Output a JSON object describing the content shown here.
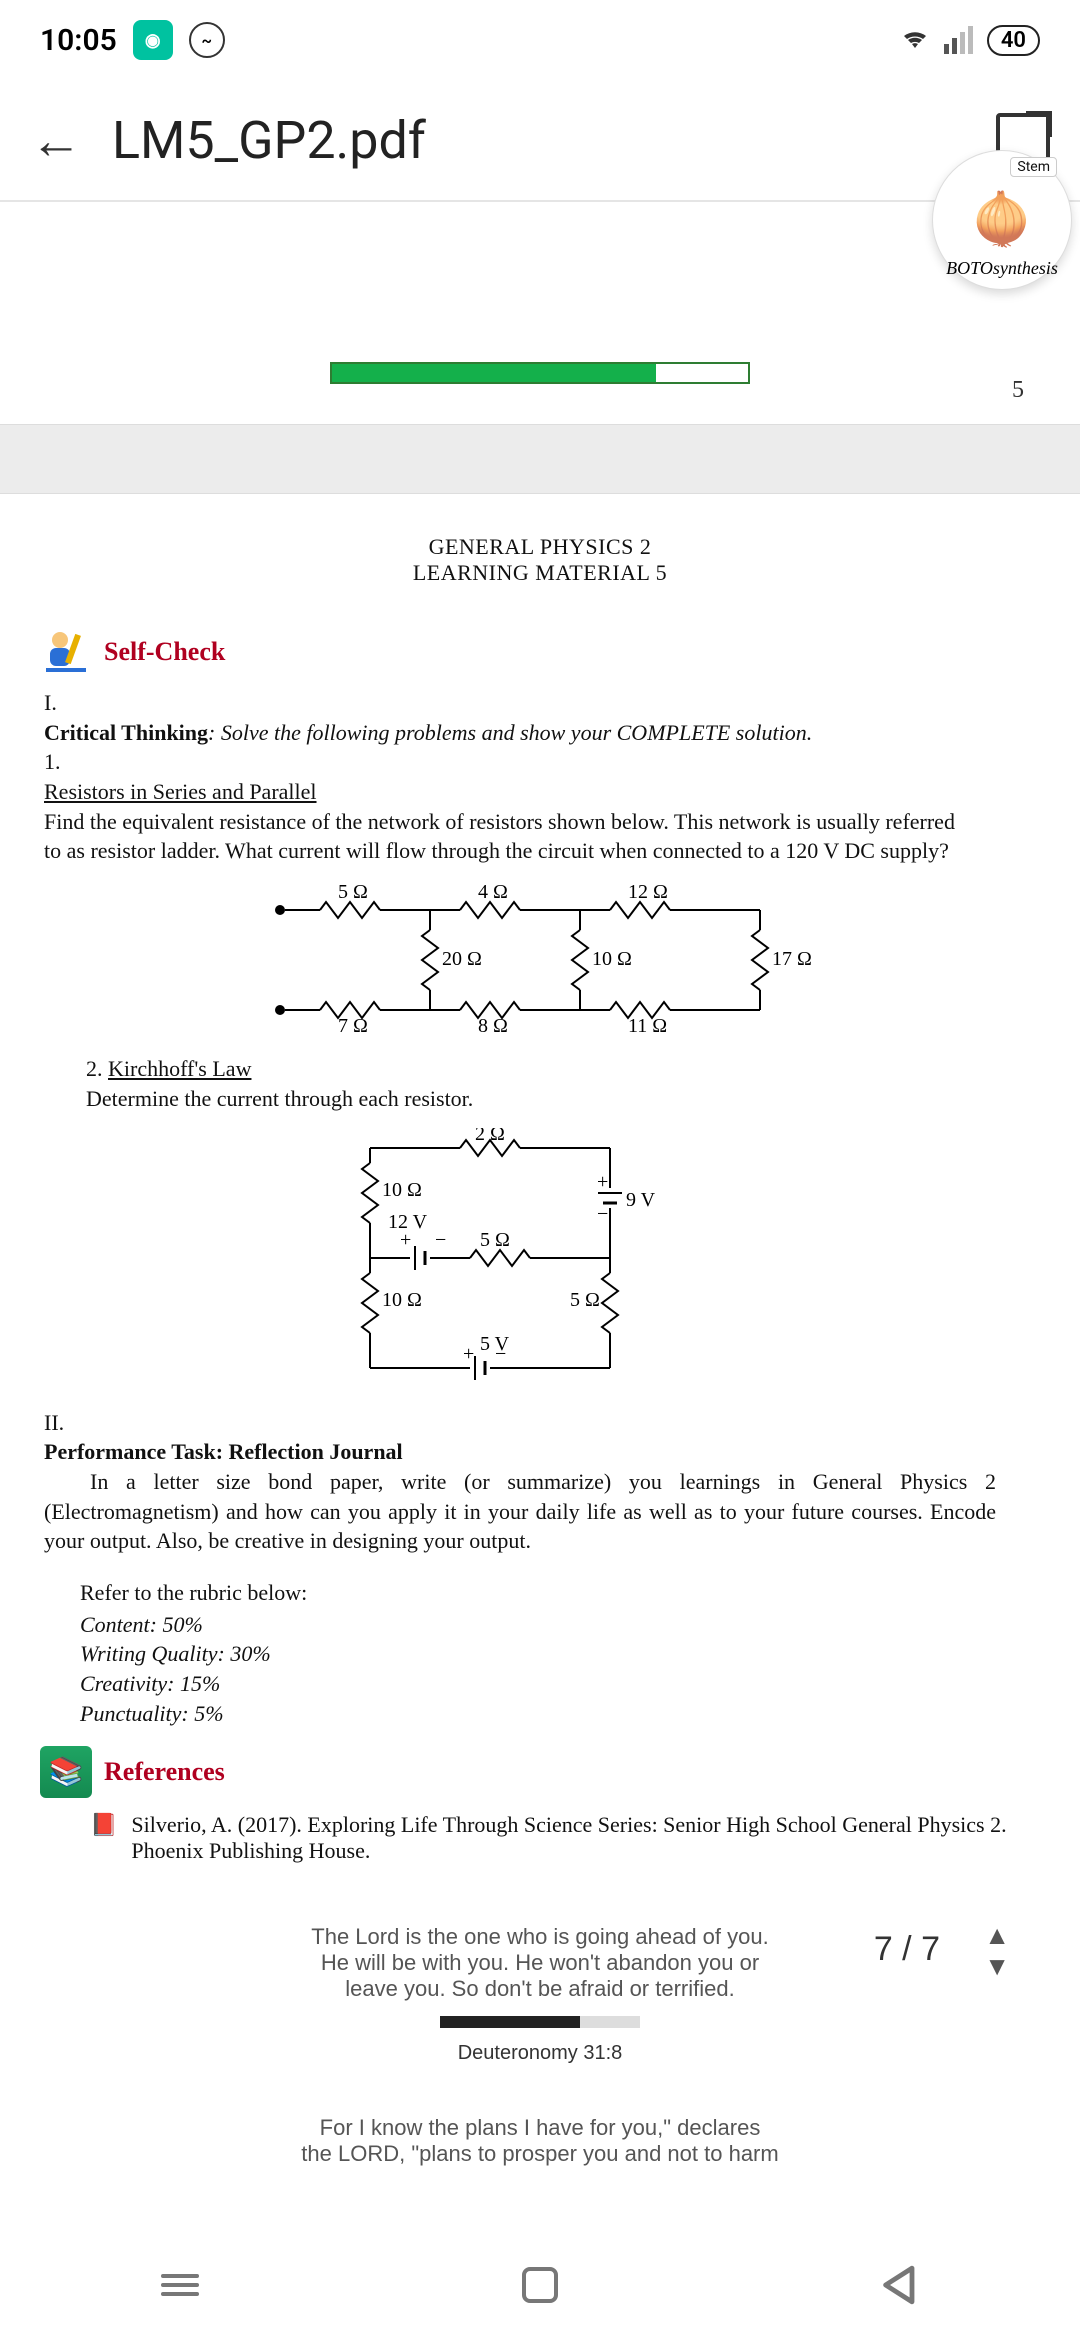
{
  "status": {
    "time": "10:05",
    "battery": "40"
  },
  "header": {
    "title": "LM5_GP2.pdf",
    "chat_tag": "Stem",
    "chat_label": "BOTOsynthesis"
  },
  "loading": {
    "progress_pct": 78,
    "page_top": "5"
  },
  "doc": {
    "heading_line1": "GENERAL PHYSICS 2",
    "heading_line2": "LEARNING MATERIAL 5",
    "selfcheck_title": "Self-Check",
    "section_I": {
      "num": "I.",
      "label": "Critical Thinking",
      "instr": ": Solve the following problems and show your COMPLETE solution.",
      "q1": {
        "num": "1.",
        "title": "Resistors in Series and Parallel",
        "text": "Find the equivalent resistance of the network of resistors shown below. This network is usually referred to as resistor ladder. What current will flow through the circuit when connected to a 120 V DC supply?"
      },
      "q2": {
        "num": "2.",
        "title": "Kirchhoff's Law",
        "text": "Determine the current through each resistor."
      }
    },
    "circuit1": {
      "r_top1": "5 Ω",
      "r_top2": "4 Ω",
      "r_top3": "12 Ω",
      "r_mid1": "20 Ω",
      "r_mid2": "10 Ω",
      "r_mid3": "17 Ω",
      "r_bot1": "7 Ω",
      "r_bot2": "8 Ω",
      "r_bot3": "11 Ω"
    },
    "circuit2": {
      "r_top": "2 Ω",
      "r_l1": "10 Ω",
      "v_l1": "12 V",
      "r_mid": "5 Ω",
      "v_r1": "9 V",
      "r_l2": "10 Ω",
      "v_bot": "5 V",
      "r_r2": "5 Ω"
    },
    "section_II": {
      "num": "II.",
      "label": "Performance Task: Reflection Journal",
      "text": "In a letter size bond paper, write (or summarize) you learnings in General Physics 2 (Electromagnetism) and how can you apply it in your daily life as well as to your future courses. Encode your output. Also, be creative in designing your output."
    },
    "rubric": {
      "head": "Refer to the rubric below:",
      "c1": "Content: 50%",
      "c2": "Writing Quality: 30%",
      "c3": "Creativity: 15%",
      "c4": "Punctuality: 5%"
    },
    "references_title": "References",
    "reference_item": "Silverio, A. (2017). Exploring Life Through Science Series: Senior High School General Physics 2. Phoenix Publishing House.",
    "footer": {
      "quote1_l1": "The Lord is the one who is going ahead of you.",
      "quote1_l2": "He will be with you. He won't abandon you or",
      "quote1_l3": "leave you. So don't be afraid or terrified.",
      "verse1": "Deuteronomy 31:8",
      "quote2_l1": "For I know the plans I have for you,\" declares",
      "quote2_l2": "the LORD, \"plans to prosper you and not to harm",
      "page_count": "7 / 7"
    }
  }
}
